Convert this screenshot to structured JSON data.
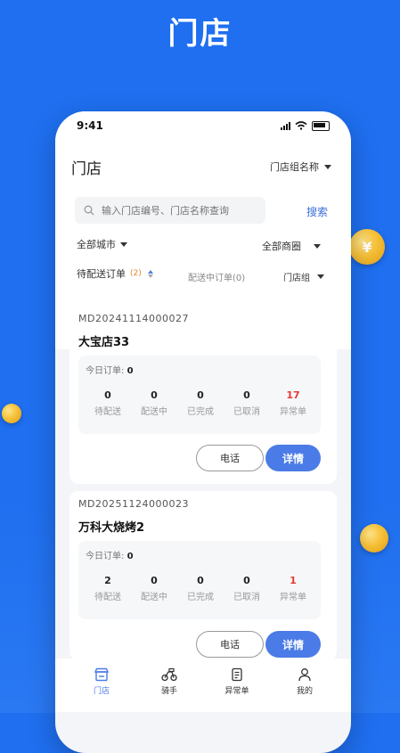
{
  "promo": {
    "title": "门店"
  },
  "status_bar": {
    "time": "9:41"
  },
  "header": {
    "title": "门店",
    "group_select": "门店组名称",
    "search_placeholder": "输入门店编号、门店名称查询",
    "search_button": "搜索",
    "city_filter": "全部城市",
    "area_filter": "全部商圈",
    "tab_pending_label": "待配送订单",
    "tab_pending_count": "(2)",
    "tab_delivering": "配送中订单(0)",
    "store_group_filter": "门店组"
  },
  "stores": [
    {
      "code": "MD20241114000027",
      "name": "大宝店33",
      "today_label": "今日订单:",
      "today_count": "0",
      "stats": [
        {
          "value": "0",
          "label": "待配送"
        },
        {
          "value": "0",
          "label": "配送中"
        },
        {
          "value": "0",
          "label": "已完成"
        },
        {
          "value": "0",
          "label": "已取消"
        },
        {
          "value": "17",
          "label": "异常单"
        }
      ],
      "phone_button": "电话",
      "detail_button": "详情"
    },
    {
      "code": "MD20251124000023",
      "name": "万科大烧烤2",
      "today_label": "今日订单:",
      "today_count": "0",
      "stats": [
        {
          "value": "2",
          "label": "待配送"
        },
        {
          "value": "0",
          "label": "配送中"
        },
        {
          "value": "0",
          "label": "已完成"
        },
        {
          "value": "0",
          "label": "已取消"
        },
        {
          "value": "1",
          "label": "异常单"
        }
      ],
      "phone_button": "电话",
      "detail_button": "详情"
    }
  ],
  "tabbar": [
    {
      "label": "门店",
      "icon": "store-icon"
    },
    {
      "label": "骑手",
      "icon": "rider-icon"
    },
    {
      "label": "异常单",
      "icon": "abnormal-order-icon"
    },
    {
      "label": "我的",
      "icon": "profile-icon"
    }
  ],
  "colors": {
    "brand": "#1f6ff0",
    "accent": "#4b7be6",
    "alert": "#e53935"
  }
}
